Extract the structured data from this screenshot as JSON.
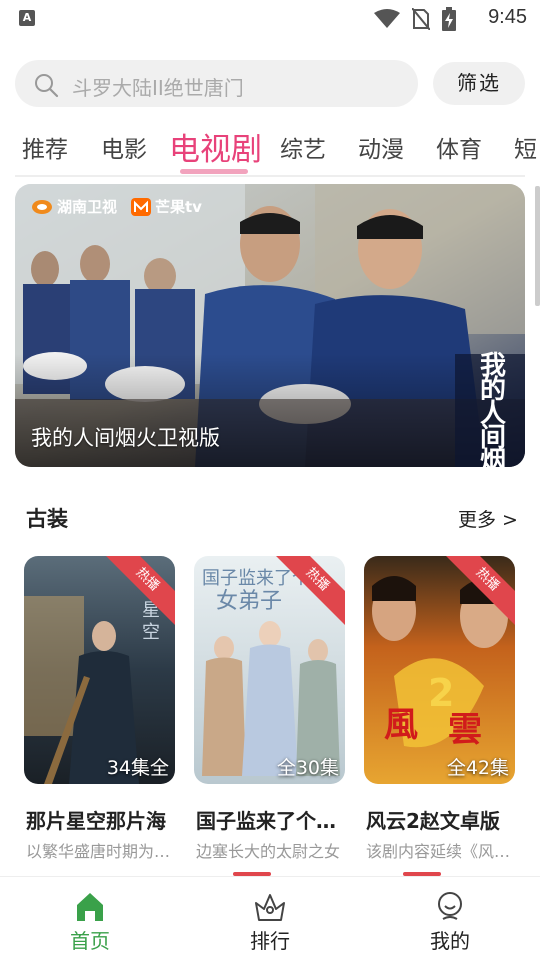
{
  "status_bar": {
    "time": "9:45",
    "notif": "A"
  },
  "search": {
    "placeholder": "斗罗大陆II绝世唐门",
    "filter_label": "筛选"
  },
  "tabs": [
    {
      "label": "推荐"
    },
    {
      "label": "电影"
    },
    {
      "label": "电视剧"
    },
    {
      "label": "综艺"
    },
    {
      "label": "动漫"
    },
    {
      "label": "体育"
    },
    {
      "label": "短"
    }
  ],
  "active_tab": "电视剧",
  "banner": {
    "logo_left": "湖南卫视",
    "logo_right": "芒果tv",
    "caption": "我的人间烟火卫视版",
    "calligraphy": "我的人间烟火"
  },
  "section": {
    "title": "古装",
    "more": "更多 >"
  },
  "cards": [
    {
      "badge": "热播",
      "episodes": "34集全",
      "title": "那片星空那片海",
      "desc": "以繁华盛唐时期为背景",
      "icon": "poster-xingkong"
    },
    {
      "badge": "热播",
      "episodes": "全30集",
      "title": "国子监来了个女弟子",
      "desc": "边塞长大的太尉之女",
      "icon": "poster-guozijian"
    },
    {
      "badge": "热播",
      "episodes": "全42集",
      "title": "风云2赵文卓版",
      "desc": "该剧内容延续《风云》",
      "icon": "poster-fengyun"
    }
  ],
  "bottom_nav": [
    {
      "label": "首页",
      "icon": "home-icon",
      "active": true
    },
    {
      "label": "排行",
      "icon": "ranking-icon",
      "active": false
    },
    {
      "label": "我的",
      "icon": "profile-icon",
      "active": false
    }
  ],
  "colors": {
    "accent": "#e8427a",
    "nav_active": "#3aa14a",
    "badge": "#e0464c"
  }
}
